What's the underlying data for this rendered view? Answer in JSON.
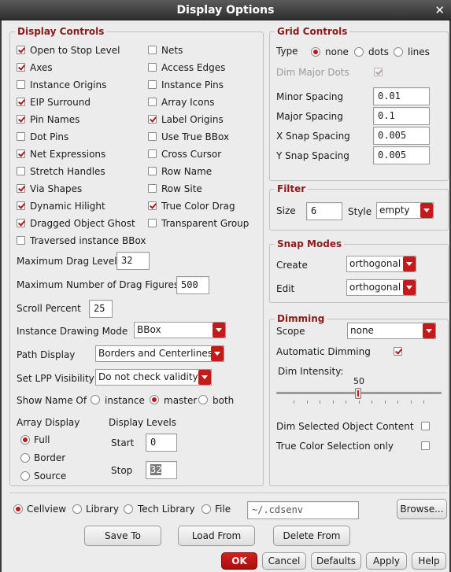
{
  "window": {
    "title": "Display Options",
    "close_glyph": "✕"
  },
  "display_controls": {
    "title": "Display Controls",
    "left_items": [
      {
        "label": "Open to Stop Level",
        "checked": true
      },
      {
        "label": "Axes",
        "checked": true
      },
      {
        "label": "Instance Origins",
        "checked": false
      },
      {
        "label": "EIP Surround",
        "checked": true
      },
      {
        "label": "Pin Names",
        "checked": true
      },
      {
        "label": "Dot Pins",
        "checked": false
      },
      {
        "label": "Net Expressions",
        "checked": true
      },
      {
        "label": "Stretch Handles",
        "checked": false
      },
      {
        "label": "Via Shapes",
        "checked": true
      },
      {
        "label": "Dynamic Hilight",
        "checked": true
      },
      {
        "label": "Dragged Object Ghost",
        "checked": true
      },
      {
        "label": "Traversed instance BBox",
        "checked": false
      }
    ],
    "right_items": [
      {
        "label": "Nets",
        "checked": false
      },
      {
        "label": "Access Edges",
        "checked": false
      },
      {
        "label": "Instance Pins",
        "checked": false
      },
      {
        "label": "Array Icons",
        "checked": false
      },
      {
        "label": "Label Origins",
        "checked": true
      },
      {
        "label": "Use True BBox",
        "checked": false
      },
      {
        "label": "Cross Cursor",
        "checked": false
      },
      {
        "label": "Row Name",
        "checked": false
      },
      {
        "label": "Row Site",
        "checked": false
      },
      {
        "label": "True Color Drag",
        "checked": true
      },
      {
        "label": "Transparent Group",
        "checked": false
      }
    ],
    "max_drag_level": {
      "label": "Maximum Drag Level",
      "value": "32"
    },
    "max_drag_figures": {
      "label": "Maximum Number of Drag Figures",
      "value": "500"
    },
    "scroll_percent": {
      "label": "Scroll Percent",
      "value": "25"
    },
    "instance_drawing_mode": {
      "label": "Instance Drawing Mode",
      "value": "BBox"
    },
    "path_display": {
      "label": "Path Display",
      "value": "Borders and Centerlines"
    },
    "set_lpp_visibility": {
      "label": "Set LPP Visibility",
      "value": "Do not check validity"
    },
    "show_name_of": {
      "label": "Show Name Of",
      "options": [
        "instance",
        "master",
        "both"
      ],
      "selected": "master"
    },
    "array_display": {
      "label": "Array Display",
      "options": [
        "Full",
        "Border",
        "Source"
      ],
      "selected": "Full"
    },
    "display_levels": {
      "label": "Display Levels",
      "start_label": "Start",
      "start_value": "0",
      "stop_label": "Stop",
      "stop_value": "32"
    }
  },
  "grid_controls": {
    "title": "Grid Controls",
    "type_label": "Type",
    "type_options": [
      "none",
      "dots",
      "lines"
    ],
    "type_selected": "none",
    "dim_major_dots": {
      "label": "Dim Major Dots",
      "checked": true,
      "disabled": true
    },
    "minor_spacing": {
      "label": "Minor Spacing",
      "value": "0.01"
    },
    "major_spacing": {
      "label": "Major Spacing",
      "value": "0.1"
    },
    "x_snap_spacing": {
      "label": "X Snap Spacing",
      "value": "0.005"
    },
    "y_snap_spacing": {
      "label": "Y Snap Spacing",
      "value": "0.005"
    }
  },
  "filter": {
    "title": "Filter",
    "size_label": "Size",
    "size_value": "6",
    "style_label": "Style",
    "style_value": "empty"
  },
  "snap_modes": {
    "title": "Snap Modes",
    "create_label": "Create",
    "create_value": "orthogonal",
    "edit_label": "Edit",
    "edit_value": "orthogonal"
  },
  "dimming": {
    "title": "Dimming",
    "scope_label": "Scope",
    "scope_value": "none",
    "automatic_label": "Automatic Dimming",
    "automatic_checked": true,
    "intensity_label": "Dim Intensity:",
    "intensity_value": "50",
    "intensity_fraction": 0.5,
    "dim_selected_label": "Dim Selected Object Content",
    "dim_selected_checked": false,
    "true_color_label": "True Color Selection only",
    "true_color_checked": false
  },
  "load_save": {
    "options": [
      "Cellview",
      "Library",
      "Tech Library",
      "File"
    ],
    "selected": "Cellview",
    "file_value": "~/.cdsenv",
    "browse_label": "Browse...",
    "save_to_label": "Save To",
    "load_from_label": "Load From",
    "delete_from_label": "Delete From"
  },
  "footer": {
    "ok_label": "OK",
    "cancel_label": "Cancel",
    "defaults_label": "Defaults",
    "apply_label": "Apply",
    "help_label": "Help"
  },
  "colors": {
    "accent": "#c41a1a",
    "title_text": "#8b1a1a"
  }
}
